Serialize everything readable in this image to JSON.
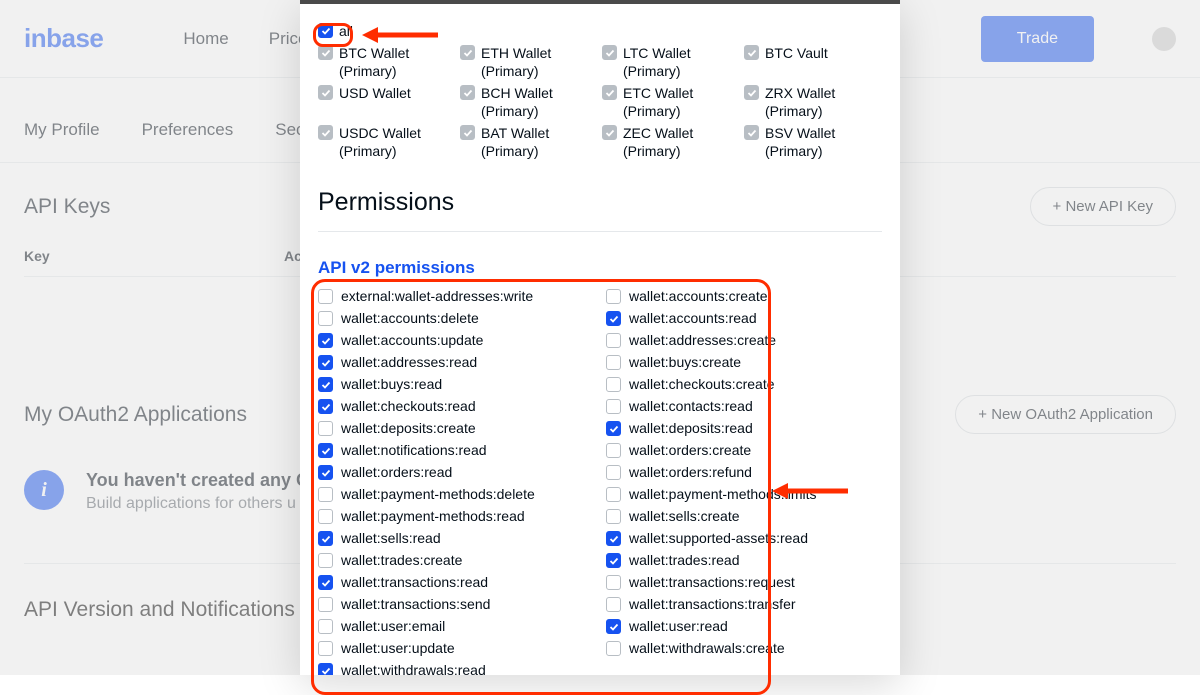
{
  "header": {
    "logo": "inbase",
    "nav": [
      "Home",
      "Prices"
    ],
    "trade": "Trade"
  },
  "subtabs": [
    "My Profile",
    "Preferences",
    "Securi"
  ],
  "api_keys": {
    "title": "API Keys",
    "new_btn": "+ New API Key",
    "col_key": "Key",
    "col_acc": "Ac"
  },
  "oauth": {
    "title": "My OAuth2 Applications",
    "new_btn": "+ New OAuth2 Application",
    "info_title": "You haven't created any OA",
    "info_sub": "Build applications for others u"
  },
  "api_version_title": "API Version and Notifications",
  "modal": {
    "all_label": "all",
    "accounts": [
      {
        "label": "all",
        "chk": "blue"
      },
      {
        "label": "BTC Wallet (Primary)",
        "chk": "gray"
      },
      {
        "label": "ETH Wallet (Primary)",
        "chk": "gray"
      },
      {
        "label": "LTC Wallet (Primary)",
        "chk": "gray"
      },
      {
        "label": "BTC Vault",
        "chk": "gray"
      },
      {
        "label": "USD Wallet",
        "chk": "gray"
      },
      {
        "label": "BCH Wallet (Primary)",
        "chk": "gray"
      },
      {
        "label": "ETC Wallet (Primary)",
        "chk": "gray"
      },
      {
        "label": "ZRX Wallet (Primary)",
        "chk": "gray"
      },
      {
        "label": "USDC Wallet (Primary)",
        "chk": "gray",
        "wrap": true
      },
      {
        "label": "BAT Wallet (Primary)",
        "chk": "gray"
      },
      {
        "label": "ZEC Wallet (Primary)",
        "chk": "gray"
      },
      {
        "label": "BSV Wallet (Primary)",
        "chk": "gray"
      }
    ],
    "permissions_header": "Permissions",
    "perm_subtitle": "API v2 permissions",
    "permissions": [
      {
        "label": "external:wallet-addresses:write",
        "checked": false
      },
      {
        "label": "wallet:accounts:create",
        "checked": false
      },
      {
        "label": "wallet:accounts:delete",
        "checked": false
      },
      {
        "label": "wallet:accounts:read",
        "checked": true
      },
      {
        "label": "wallet:accounts:update",
        "checked": true
      },
      {
        "label": "wallet:addresses:create",
        "checked": false
      },
      {
        "label": "wallet:addresses:read",
        "checked": true
      },
      {
        "label": "wallet:buys:create",
        "checked": false
      },
      {
        "label": "wallet:buys:read",
        "checked": true
      },
      {
        "label": "wallet:checkouts:create",
        "checked": false
      },
      {
        "label": "wallet:checkouts:read",
        "checked": true
      },
      {
        "label": "wallet:contacts:read",
        "checked": false
      },
      {
        "label": "wallet:deposits:create",
        "checked": false
      },
      {
        "label": "wallet:deposits:read",
        "checked": true
      },
      {
        "label": "wallet:notifications:read",
        "checked": true
      },
      {
        "label": "wallet:orders:create",
        "checked": false
      },
      {
        "label": "wallet:orders:read",
        "checked": true
      },
      {
        "label": "wallet:orders:refund",
        "checked": false
      },
      {
        "label": "wallet:payment-methods:delete",
        "checked": false
      },
      {
        "label": "wallet:payment-methods:limits",
        "checked": false
      },
      {
        "label": "wallet:payment-methods:read",
        "checked": false
      },
      {
        "label": "wallet:sells:create",
        "checked": false
      },
      {
        "label": "wallet:sells:read",
        "checked": true
      },
      {
        "label": "wallet:supported-assets:read",
        "checked": true
      },
      {
        "label": "wallet:trades:create",
        "checked": false
      },
      {
        "label": "wallet:trades:read",
        "checked": true
      },
      {
        "label": "wallet:transactions:read",
        "checked": true
      },
      {
        "label": "wallet:transactions:request",
        "checked": false
      },
      {
        "label": "wallet:transactions:send",
        "checked": false
      },
      {
        "label": "wallet:transactions:transfer",
        "checked": false
      },
      {
        "label": "wallet:user:email",
        "checked": false
      },
      {
        "label": "wallet:user:read",
        "checked": true
      },
      {
        "label": "wallet:user:update",
        "checked": false
      },
      {
        "label": "wallet:withdrawals:create",
        "checked": false
      },
      {
        "label": "wallet:withdrawals:read",
        "checked": true
      }
    ]
  }
}
